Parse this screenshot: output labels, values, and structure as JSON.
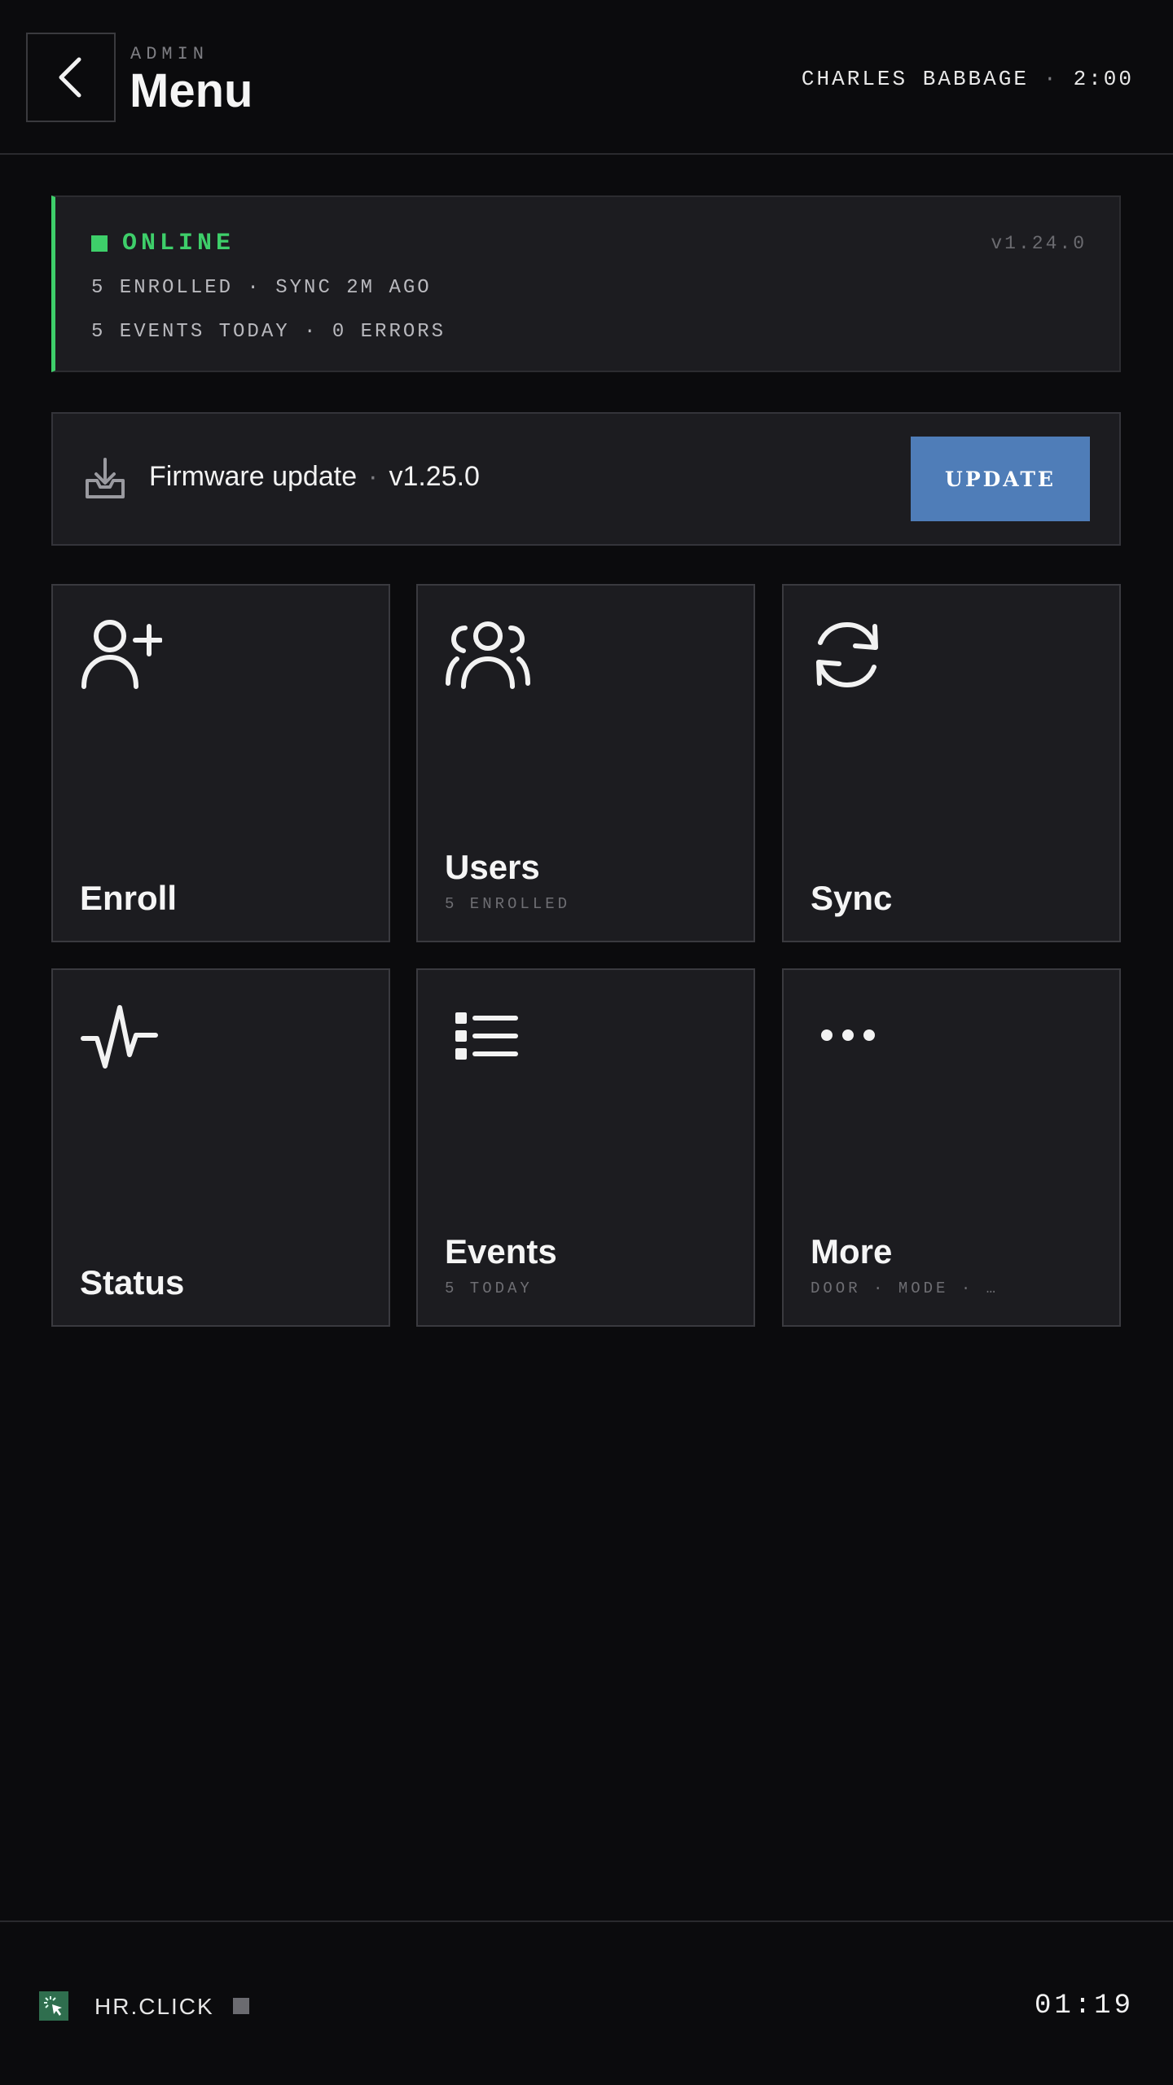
{
  "header": {
    "kicker": "ADMIN",
    "title": "Menu",
    "user_name": "CHARLES BABBAGE",
    "separator": "·",
    "time": "2:00"
  },
  "status": {
    "state": "ONLINE",
    "version": "v1.24.0",
    "line1": "5 ENROLLED · SYNC 2M AGO",
    "line2": "5 EVENTS TODAY · 0 ERRORS",
    "color": "#3ecf6a"
  },
  "firmware": {
    "label": "Firmware update",
    "separator": "·",
    "version": "v1.25.0",
    "button_label": "UPDATE",
    "button_color": "#4f7db8"
  },
  "tiles": [
    {
      "label": "Enroll",
      "sub": "",
      "icon": "user-plus-icon"
    },
    {
      "label": "Users",
      "sub": "5 ENROLLED",
      "icon": "users-icon"
    },
    {
      "label": "Sync",
      "sub": "",
      "icon": "refresh-icon"
    },
    {
      "label": "Status",
      "sub": "",
      "icon": "activity-icon"
    },
    {
      "label": "Events",
      "sub": "5 TODAY",
      "icon": "list-icon"
    },
    {
      "label": "More",
      "sub": "DOOR · MODE · …",
      "icon": "more-icon"
    }
  ],
  "footer": {
    "brand": "HR.CLICK",
    "clock": "01:19",
    "brand_color": "#2f6e4e"
  }
}
